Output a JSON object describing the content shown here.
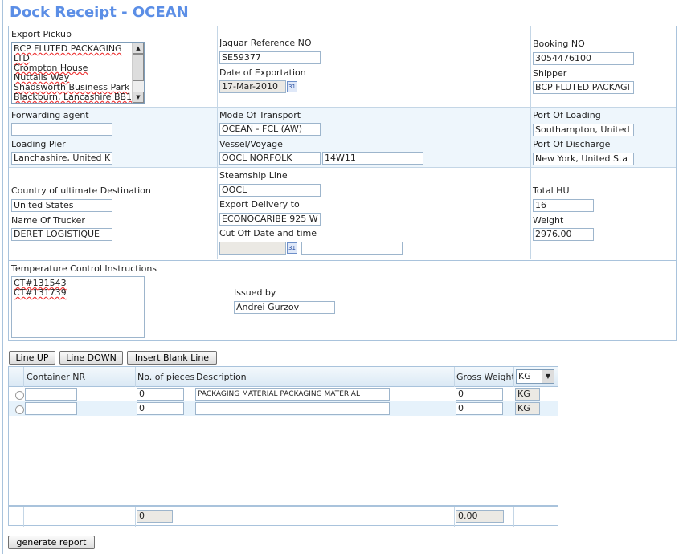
{
  "title": "Dock Receipt - OCEAN",
  "colors": {
    "title": "#5b8ee6",
    "band": "#eef6fc",
    "border": "#a9c3dc"
  },
  "export_pickup": {
    "label": "Export Pickup",
    "lines": [
      "BCP FLUTED PACKAGING",
      "LTD",
      "Crompton House",
      "Nuttalls Way",
      "Shadsworth Business Park",
      "Blackburn, Lancashire BB1"
    ]
  },
  "jaguar_ref": {
    "label": "Jaguar Reference NO",
    "value": "SE59377"
  },
  "date_export": {
    "label": "Date of Exportation",
    "value": "17-Mar-2010",
    "icon": "calendar-icon"
  },
  "booking_no": {
    "label": "Booking NO",
    "value": "3054476100"
  },
  "shipper": {
    "label": "Shipper",
    "value": "BCP FLUTED PACKAGI"
  },
  "forwarding_agent": {
    "label": "Forwarding agent",
    "value": ""
  },
  "loading_pier": {
    "label": "Loading Pier",
    "value": "Lanchashire, United K"
  },
  "mode_transport": {
    "label": "Mode Of Transport",
    "value": "OCEAN - FCL (AW)"
  },
  "vessel_voyage": {
    "label": "Vessel/Voyage",
    "vessel": "OOCL NORFOLK",
    "voyage": "14W11"
  },
  "port_loading": {
    "label": "Port Of Loading",
    "value": "Southampton, United"
  },
  "port_discharge": {
    "label": "Port Of Discharge",
    "value": "New York, United Sta"
  },
  "country_dest": {
    "label": "Country of ultimate Destination",
    "value": "United States"
  },
  "trucker": {
    "label": "Name Of Trucker",
    "value": "DERET LOGISTIQUE"
  },
  "steamship": {
    "label": "Steamship Line",
    "value": "OOCL"
  },
  "export_delivery": {
    "label": "Export Delivery to",
    "value": "ECONOCARIBE 925 W"
  },
  "cutoff": {
    "label": "Cut Off Date and time",
    "date": "",
    "time": ""
  },
  "total_hu": {
    "label": "Total HU",
    "value": "16"
  },
  "weight": {
    "label": "Weight",
    "value": "2976.00"
  },
  "temperature": {
    "label": "Temperature Control Instructions",
    "lines": [
      "CT#131543",
      "CT#131739"
    ]
  },
  "issued_by": {
    "label": "Issued by",
    "value": "Andrei Gurzov"
  },
  "buttons": {
    "line_up": "Line UP",
    "line_down": "Line DOWN",
    "insert_blank": "Insert Blank Line",
    "generate": "generate report"
  },
  "grid": {
    "headers": {
      "container": "Container NR",
      "pieces": "No. of pieces",
      "description": "Description",
      "gross": "Gross Weight",
      "unit_select": "KG"
    },
    "rows": [
      {
        "container": "",
        "pieces": "0",
        "description": "PACKAGING MATERIAL PACKAGING MATERIAL",
        "gross": "0",
        "unit": "KG"
      },
      {
        "container": "",
        "pieces": "0",
        "description": "",
        "gross": "0",
        "unit": "KG"
      }
    ],
    "totals": {
      "pieces": "0",
      "gross": "0.00"
    }
  }
}
